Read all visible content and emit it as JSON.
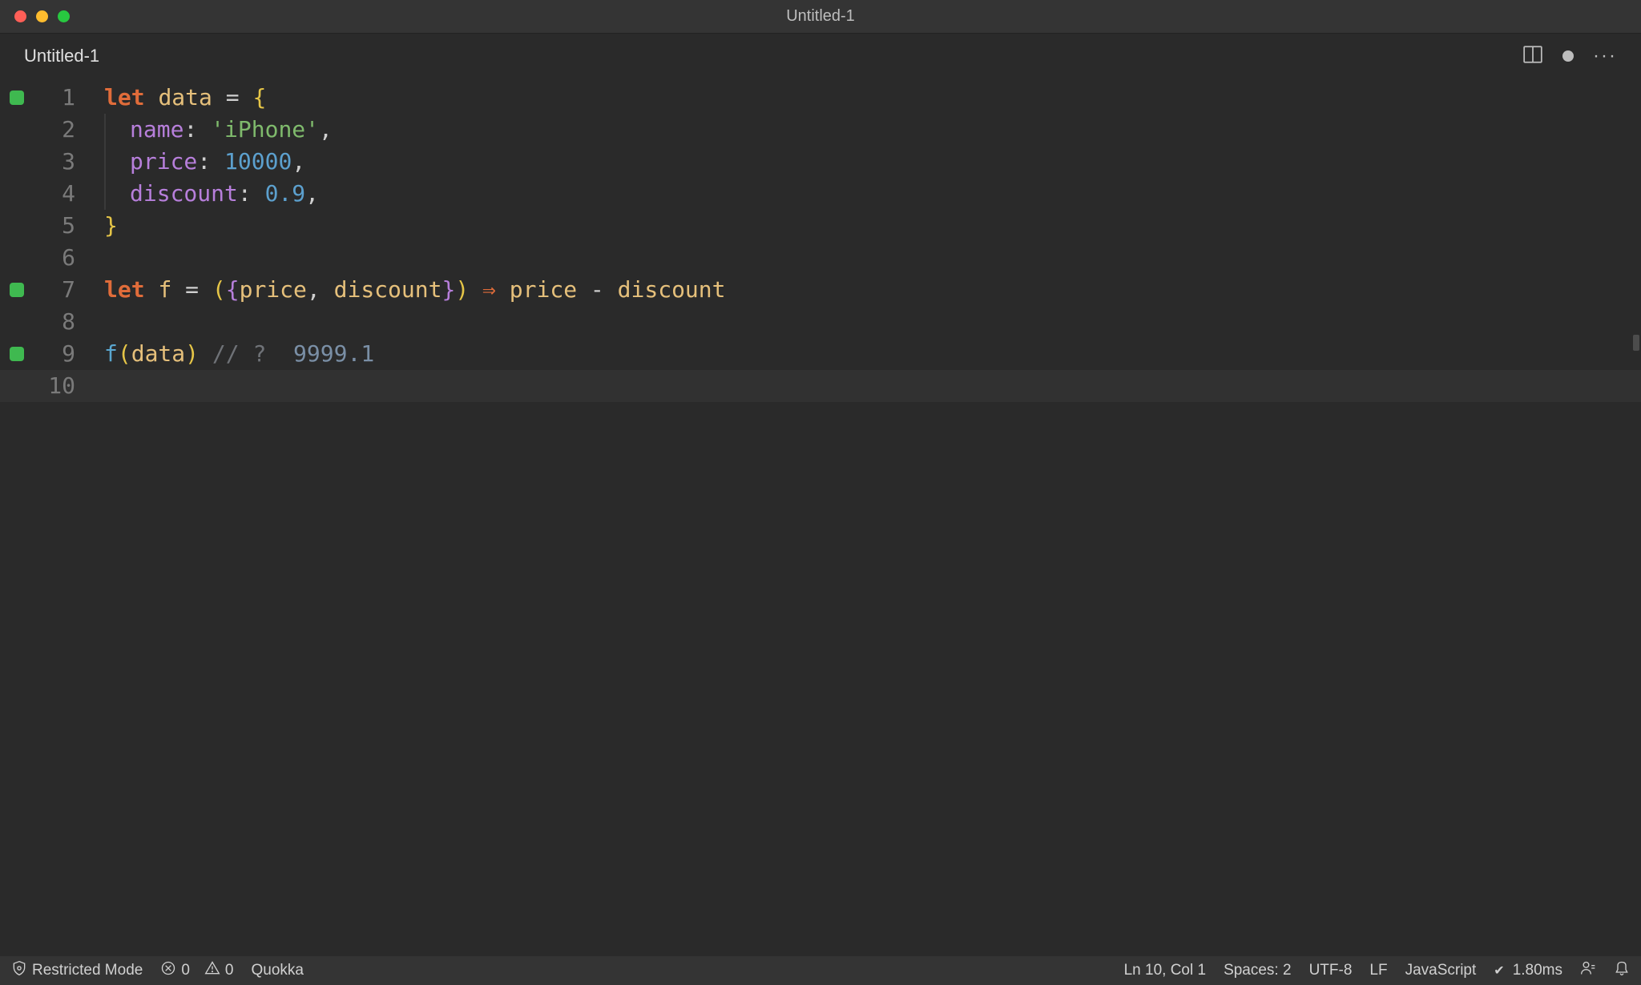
{
  "window": {
    "title": "Untitled-1"
  },
  "tab": {
    "label": "Untitled-1"
  },
  "gutter": {
    "lines": [
      "1",
      "2",
      "3",
      "4",
      "5",
      "6",
      "7",
      "8",
      "9",
      "10"
    ]
  },
  "code": {
    "l1": {
      "kw": "let",
      "id": "data",
      "eq": " = ",
      "br": "{"
    },
    "l2": {
      "prop": "name",
      "colon": ": ",
      "str": "'iPhone'",
      "comma": ","
    },
    "l3": {
      "prop": "price",
      "colon": ": ",
      "num": "10000",
      "comma": ","
    },
    "l4": {
      "prop": "discount",
      "colon": ": ",
      "num": "0.9",
      "comma": ","
    },
    "l5": {
      "br": "}"
    },
    "l7": {
      "kw": "let",
      "id": "f",
      "eq": " = ",
      "lp": "(",
      "lb": "{",
      "p1": "price",
      "c": ", ",
      "p2": "discount",
      "rb": "}",
      "rp": ")",
      "arrow": " ⇒ ",
      "e1": "price",
      "minus": " - ",
      "e2": "discount"
    },
    "l9": {
      "fn": "f",
      "lp": "(",
      "arg": "data",
      "rp": ")",
      "sp": " ",
      "cm": "// ?",
      "sp2": "  ",
      "val": "9999.1"
    }
  },
  "status": {
    "restricted": "Restricted Mode",
    "errors": "0",
    "warnings": "0",
    "quokka": "Quokka",
    "lncol": "Ln 10, Col 1",
    "spaces": "Spaces: 2",
    "encoding": "UTF-8",
    "eol": "LF",
    "language": "JavaScript",
    "timing": "1.80ms"
  }
}
